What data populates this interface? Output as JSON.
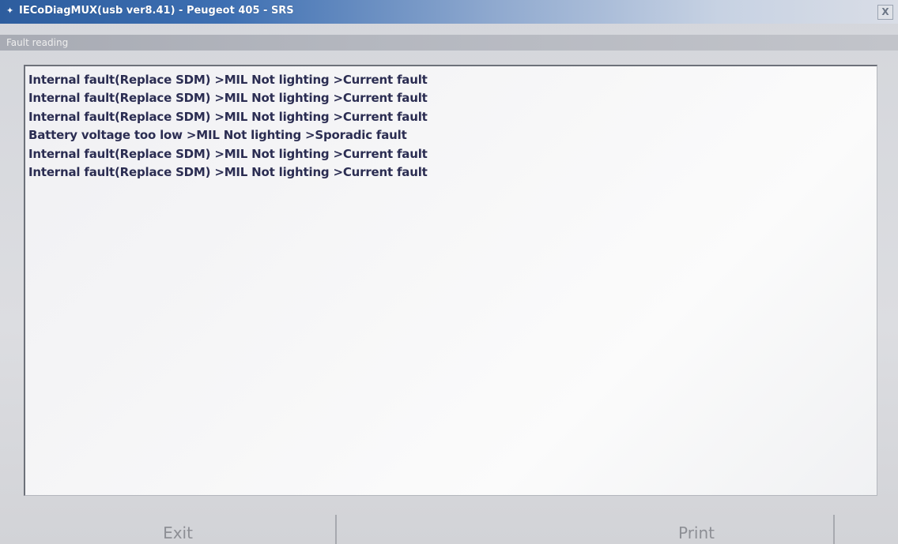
{
  "window": {
    "title": "IECoDiagMUX(usb ver8.41) - Peugeot 405 - SRS",
    "close_label": "X"
  },
  "section": {
    "title": "Fault reading"
  },
  "faults": [
    "Internal fault(Replace SDM) >MIL Not lighting >Current fault",
    "Internal fault(Replace SDM) >MIL Not lighting >Current fault",
    "Internal fault(Replace SDM) >MIL Not lighting >Current fault",
    "Battery voltage too low >MIL Not lighting >Sporadic fault",
    "Internal fault(Replace SDM) >MIL Not lighting >Current fault",
    "Internal fault(Replace SDM) >MIL Not lighting >Current fault"
  ],
  "buttons": {
    "exit": "Exit",
    "print": "Print"
  },
  "icons": {
    "app": "app-icon",
    "close": "close-icon"
  },
  "colors": {
    "title_bar": "#2d5d9e",
    "fault_text": "#2b2d52",
    "panel_background": "#f7f7f8"
  }
}
